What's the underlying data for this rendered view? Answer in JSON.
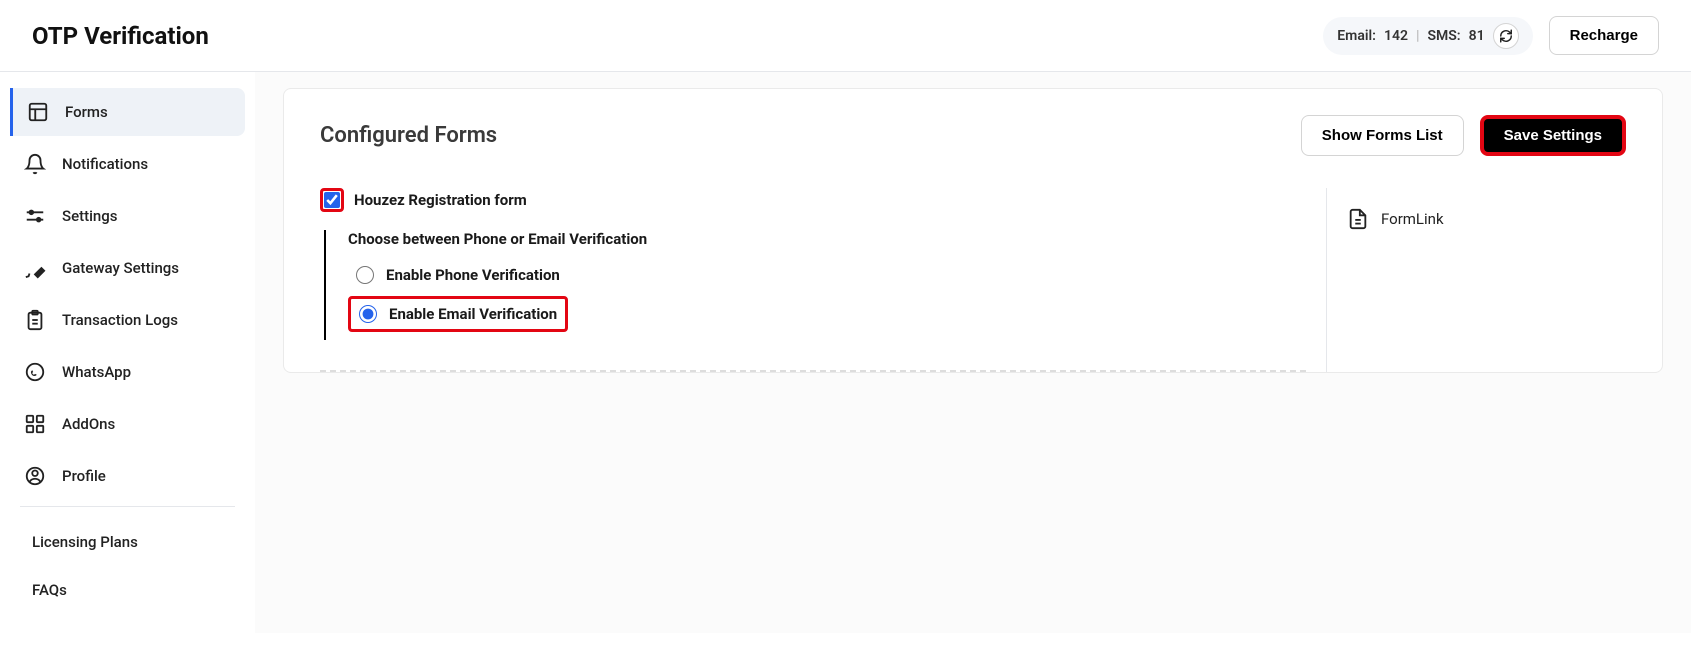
{
  "header": {
    "title": "OTP Verification",
    "email_label": "Email:",
    "email_count": "142",
    "sms_label": "SMS: ",
    "sms_count": "81",
    "recharge_label": "Recharge"
  },
  "sidebar": {
    "items": [
      {
        "label": "Forms"
      },
      {
        "label": "Notifications"
      },
      {
        "label": "Settings"
      },
      {
        "label": "Gateway Settings"
      },
      {
        "label": "Transaction Logs"
      },
      {
        "label": "WhatsApp"
      },
      {
        "label": "AddOns"
      },
      {
        "label": "Profile"
      }
    ],
    "plain": [
      {
        "label": "Licensing Plans"
      },
      {
        "label": "FAQs"
      }
    ]
  },
  "main": {
    "title": "Configured Forms",
    "show_forms_label": "Show Forms List",
    "save_label": "Save Settings",
    "form_name": "Houzez Registration form",
    "choose_heading": "Choose between Phone or Email Verification",
    "phone_option": "Enable Phone Verification",
    "email_option": "Enable Email Verification",
    "formlink_label": "FormLink"
  }
}
